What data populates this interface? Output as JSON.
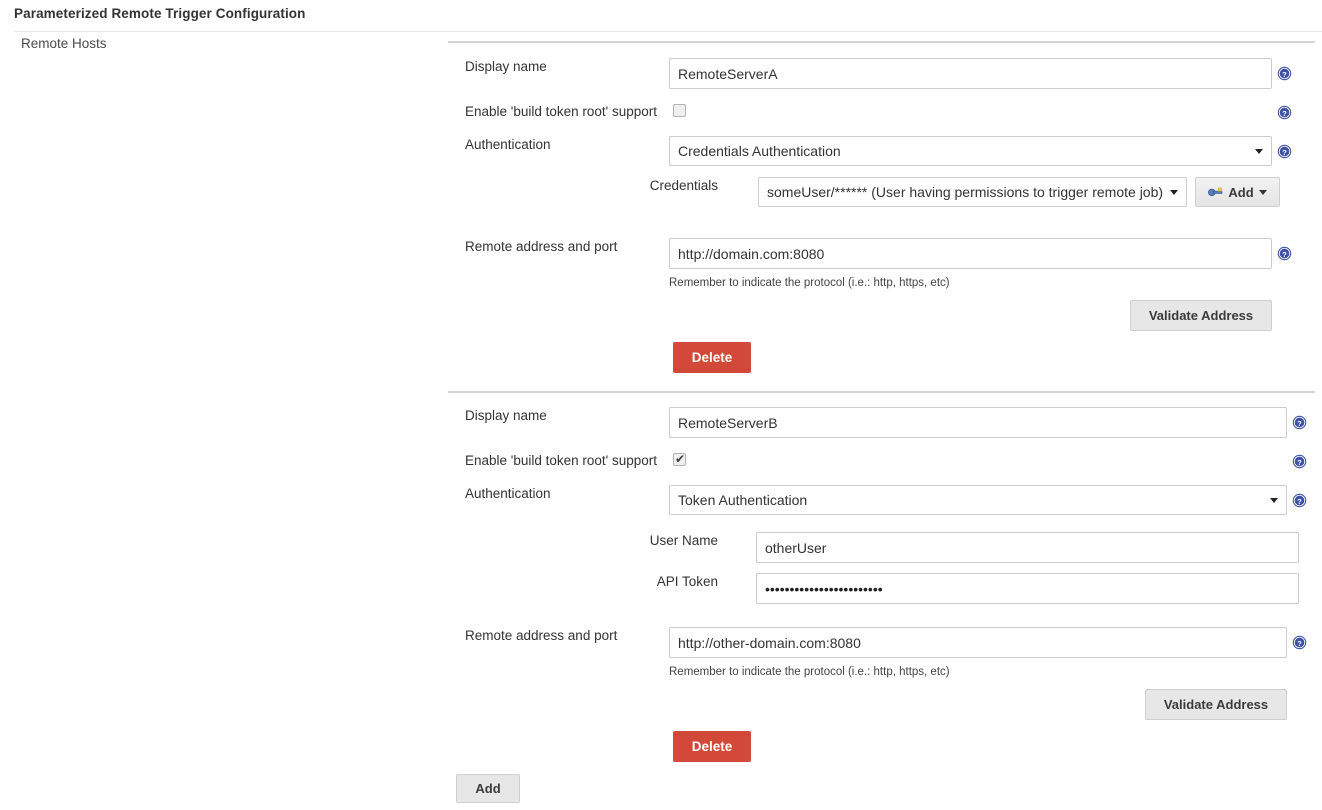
{
  "header": {
    "title": "Parameterized Remote Trigger Configuration",
    "section_label": "Remote Hosts"
  },
  "labels": {
    "display_name": "Display name",
    "build_token_root": "Enable 'build token root' support",
    "authentication": "Authentication",
    "credentials": "Credentials",
    "user_name": "User Name",
    "api_token": "API Token",
    "remote_address": "Remote address and port",
    "protocol_hint": "Remember to indicate the protocol (i.e.: http, https, etc)"
  },
  "buttons": {
    "validate_address": "Validate Address",
    "delete": "Delete",
    "add": "Add",
    "add_credentials": "Add"
  },
  "icons": {
    "help": "help-icon",
    "key": "key-icon",
    "caret_down": "chevron-down-icon",
    "checkmark": "✔"
  },
  "colors": {
    "delete_button": "#d24939",
    "help_icon": "#3f51a6",
    "grey_button": "#e7e7e7",
    "border": "#cccccc",
    "divider": "#d4d4d4"
  },
  "hosts": [
    {
      "display_name": "RemoteServerA",
      "build_token_root_checked": false,
      "authentication": "Credentials Authentication",
      "credentials": "someUser/****** (User having permissions to trigger remote job)",
      "remote_address": "http://domain.com:8080"
    },
    {
      "display_name": "RemoteServerB",
      "build_token_root_checked": true,
      "authentication": "Token Authentication",
      "user_name": "otherUser",
      "api_token": "••••••••••••••••••••••••",
      "remote_address": "http://other-domain.com:8080"
    }
  ]
}
